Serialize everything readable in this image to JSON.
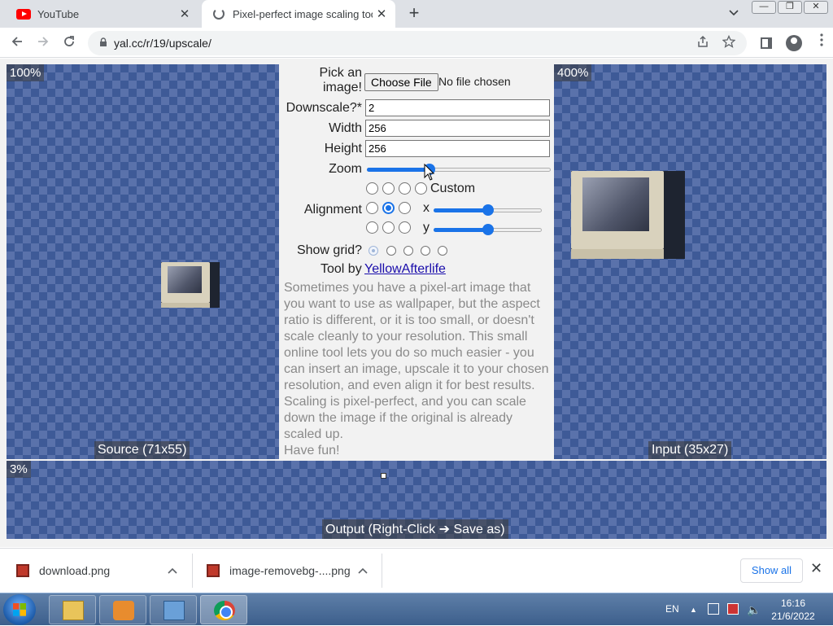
{
  "browser": {
    "tabs": [
      {
        "title": "YouTube",
        "close": "✕"
      },
      {
        "title": "Pixel-perfect image scaling tool",
        "close": "✕"
      }
    ],
    "new_tab": "+",
    "tab_menu": "⌄",
    "url": "yal.cc/r/19/upscale/"
  },
  "panels": {
    "source": {
      "zoom": "100%",
      "caption": "Source (71x55)"
    },
    "input": {
      "zoom": "400%",
      "caption": "Input (35x27)"
    },
    "output": {
      "zoom": "3%",
      "caption": "Output (Right-Click ➔ Save as)"
    }
  },
  "controls": {
    "pick_label_1": "Pick an",
    "pick_label_2": "image!",
    "choose_file": "Choose File",
    "no_file": "No file chosen",
    "downscale_label": "Downscale?*",
    "downscale_value": "2",
    "width_label": "Width",
    "width_value": "256",
    "height_label": "Height",
    "height_value": "256",
    "zoom_label": "Zoom",
    "zoom_level": 0.34,
    "custom_label": "Custom",
    "alignment_label": "Alignment",
    "x_label": "x",
    "y_label": "y",
    "x_level": 0.5,
    "y_level": 0.5,
    "grid_label": "Show grid?",
    "tool_by": "Tool by",
    "author": "YellowAfterlife",
    "description": "Sometimes you have a pixel-art image that you want to use as wallpaper, but the aspect ratio is different, or it is too small, or doesn't scale cleanly to your resolution. This small online tool lets you do so much easier - you can insert an image, upscale it to your chosen resolution, and even align it for best results. Scaling is pixel-perfect, and you can scale down the image if the original is already scaled up.",
    "have_fun": "Have fun!"
  },
  "downloads": {
    "items": [
      {
        "name": "download.png"
      },
      {
        "name": "image-removebg-....png"
      }
    ],
    "show_all": "Show all"
  },
  "taskbar": {
    "language": "EN",
    "time": "16:16",
    "date": "21/6/2022"
  }
}
